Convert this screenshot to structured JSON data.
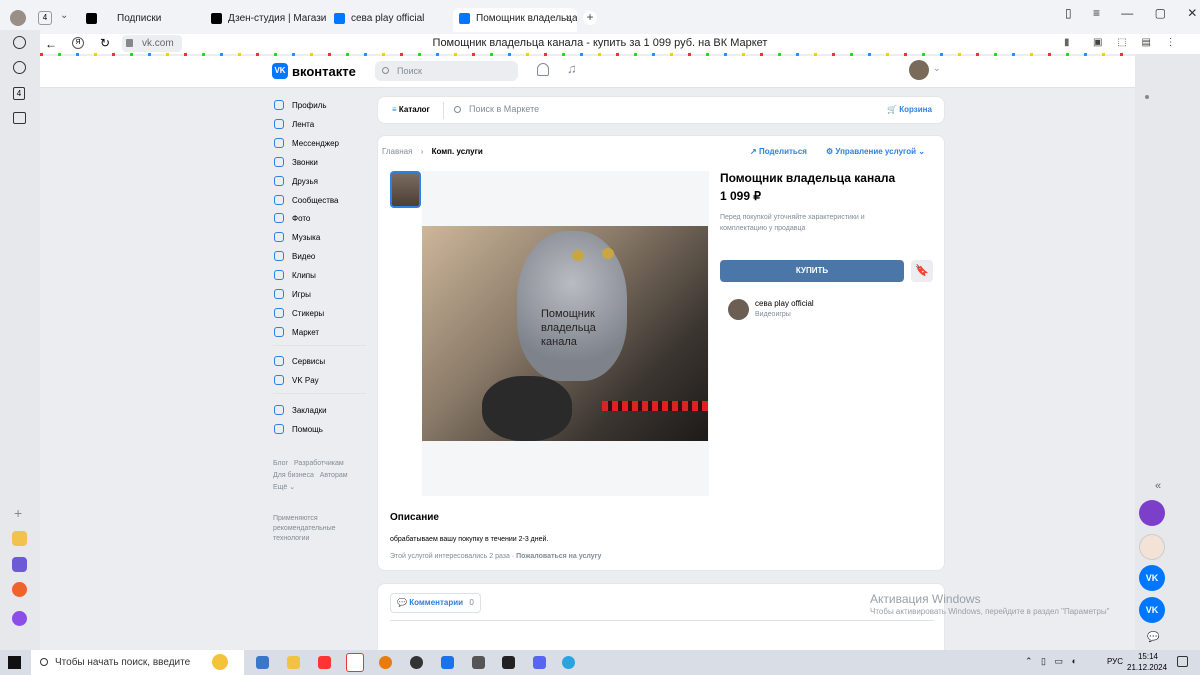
{
  "browser": {
    "counter_tab": "4",
    "tabs": [
      "Подписки",
      "Дзен-студия | Магазин п",
      "сева play official",
      "Помощник владельца"
    ],
    "address": "vk.com",
    "page_title": "Помощник владельца канала - купить за 1 099 руб. на ВК Маркет"
  },
  "vk": {
    "logo": "вконтакте",
    "search_placeholder": "Поиск",
    "nav": [
      {
        "label": "Профиль",
        "icon": "user-icon"
      },
      {
        "label": "Лента",
        "icon": "feed-icon"
      },
      {
        "label": "Мессенджер",
        "icon": "chat-icon"
      },
      {
        "label": "Звонки",
        "icon": "phone-icon"
      },
      {
        "label": "Друзья",
        "icon": "friends-icon"
      },
      {
        "label": "Сообщества",
        "icon": "groups-icon"
      },
      {
        "label": "Фото",
        "icon": "photo-icon"
      },
      {
        "label": "Музыка",
        "icon": "music-icon"
      },
      {
        "label": "Видео",
        "icon": "video-icon"
      },
      {
        "label": "Клипы",
        "icon": "clips-icon"
      },
      {
        "label": "Игры",
        "icon": "games-icon"
      },
      {
        "label": "Стикеры",
        "icon": "stickers-icon"
      },
      {
        "label": "Маркет",
        "icon": "market-icon"
      }
    ],
    "nav2": [
      {
        "label": "Сервисы",
        "icon": "services-icon"
      },
      {
        "label": "VK Pay",
        "icon": "vkpay-icon"
      }
    ],
    "nav3": [
      {
        "label": "Закладки",
        "icon": "bookmarks-icon"
      },
      {
        "label": "Помощь",
        "icon": "help-icon"
      }
    ],
    "footer": {
      "blog": "Блог",
      "dev": "Разработчикам",
      "business": "Для бизнеса",
      "authors": "Авторам",
      "more": "Ещё",
      "tech": "Применяются рекомендательные технологии"
    }
  },
  "market": {
    "catalog": "Каталог",
    "search_placeholder": "Поиск в Маркете",
    "cart": "Корзина",
    "breadcrumb_home": "Главная",
    "breadcrumb_current": "Комп. услуги",
    "share": "Поделиться",
    "manage": "Управление услугой",
    "image_caption": "Помощник владельца канала",
    "title": "Помощник владельца канала",
    "price": "1 099 ₽",
    "note": "Перед покупкой уточняйте характеристики и комплектацию у продавца",
    "buy": "КУПИТЬ",
    "seller_name": "сева play official",
    "seller_category": "Видеоигры",
    "desc_title": "Описание",
    "desc_text": "обрабатываем вашу покупку в течении 2-3 дней.",
    "interest": "Этой услугой интересовались 2 раза",
    "complain": "Пожаловаться на услугу",
    "comments": "Комментарии",
    "comments_count": "0"
  },
  "overlay": {
    "activation_title": "Активация Windows",
    "activation_text": "Чтобы активировать Windows, перейдите в раздел \"Параметры\""
  },
  "taskbar": {
    "search_placeholder": "Чтобы начать поиск, введите",
    "lang": "РУС",
    "time": "15:14",
    "date": "21.12.2024"
  }
}
